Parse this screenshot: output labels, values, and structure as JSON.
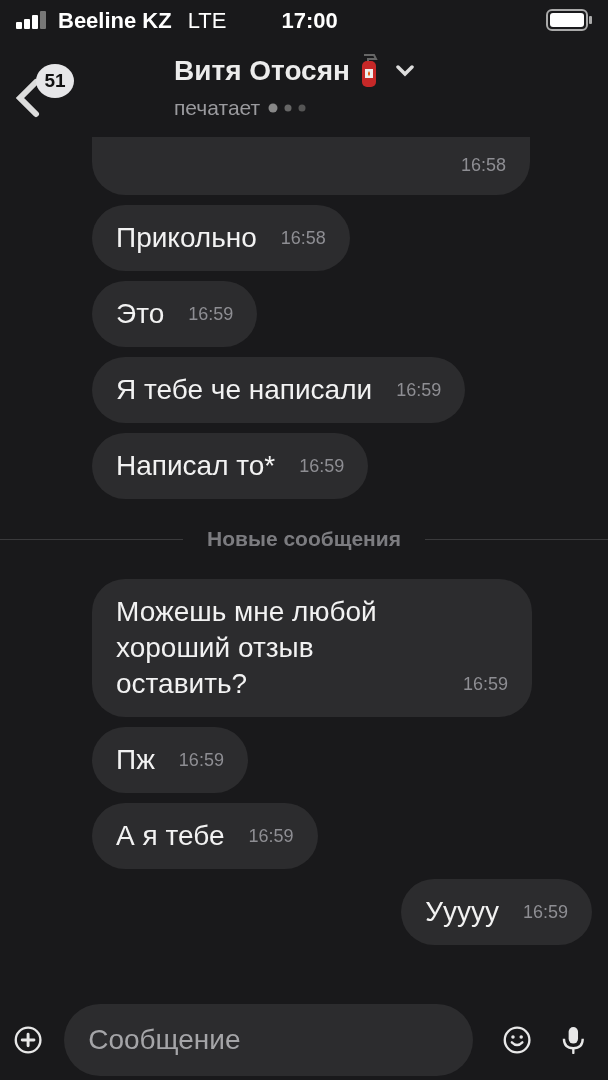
{
  "status_bar": {
    "carrier": "Beeline KZ",
    "network": "LTE",
    "time": "17:00"
  },
  "header": {
    "unread_count": "51",
    "name": "Витя Отосян",
    "status": "печатает"
  },
  "messages": [
    {
      "kind": "cut",
      "time": "16:58"
    },
    {
      "kind": "incoming",
      "text": "Прикольно",
      "time": "16:58"
    },
    {
      "kind": "incoming",
      "text": "Это",
      "time": "16:59"
    },
    {
      "kind": "incoming",
      "text": "Я тебе че написали",
      "time": "16:59"
    },
    {
      "kind": "incoming",
      "text": "Написал то*",
      "time": "16:59"
    },
    {
      "kind": "divider",
      "text": "Новые сообщения"
    },
    {
      "kind": "incoming",
      "text": "Можешь мне любой хороший отзыв оставить?",
      "time": "16:59"
    },
    {
      "kind": "incoming",
      "text": "Пж",
      "time": "16:59"
    },
    {
      "kind": "incoming",
      "text": "А я тебе",
      "time": "16:59"
    },
    {
      "kind": "outgoing",
      "text": "Ууууу",
      "time": "16:59"
    }
  ],
  "composer": {
    "placeholder": "Сообщение"
  }
}
